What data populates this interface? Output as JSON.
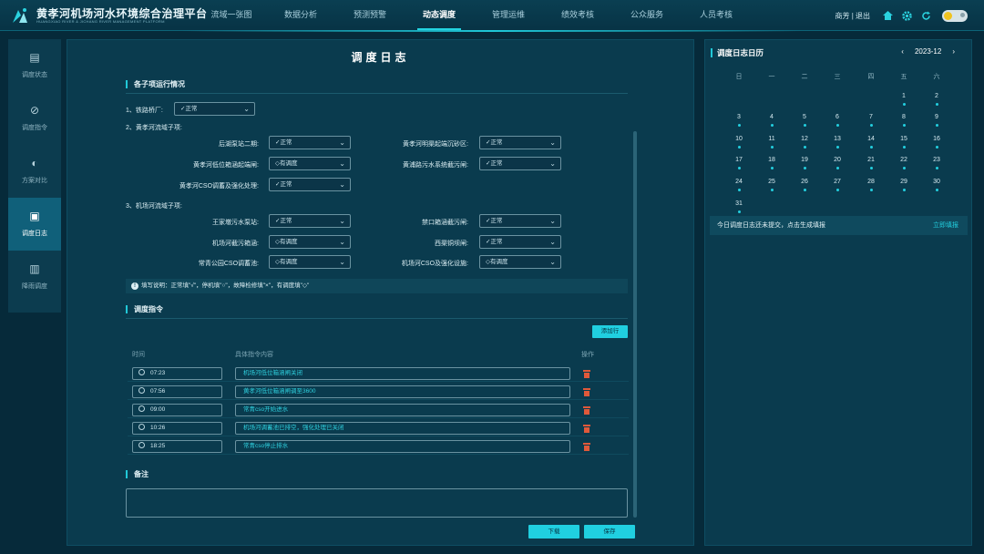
{
  "app": {
    "title": "黄孝河机场河水环境综合治理平台",
    "subtitle": "HUANGXIAO RIVER & JICHANG RIVER MANAGEMENT PLATFORM"
  },
  "nav": [
    {
      "label": "流域一张图",
      "active": false
    },
    {
      "label": "数据分析",
      "active": false
    },
    {
      "label": "预测预警",
      "active": false
    },
    {
      "label": "动态调度",
      "active": true
    },
    {
      "label": "管理运维",
      "active": false
    },
    {
      "label": "绩效考核",
      "active": false
    },
    {
      "label": "公众服务",
      "active": false
    },
    {
      "label": "人员考核",
      "active": false
    }
  ],
  "user": {
    "text": "商芳 | 退出"
  },
  "sidebar": [
    {
      "label": "调度状态",
      "icon": "clipboard-icon",
      "active": false
    },
    {
      "label": "调度指令",
      "icon": "instruction-icon",
      "active": false
    },
    {
      "label": "方案对比",
      "icon": "compare-icon",
      "active": false
    },
    {
      "label": "调度日志",
      "icon": "log-icon",
      "active": true
    },
    {
      "label": "降雨调度",
      "icon": "rain-icon",
      "active": false
    }
  ],
  "main": {
    "title": "调度日志",
    "section1": "各子项运行情况",
    "group1_label": "1、铁路桥厂:",
    "group1_value": "✓正常",
    "group2_label": "2、黄孝河流域子项:",
    "group3_label": "3、机场河流域子项:",
    "items": {
      "houhu": {
        "label": "后湖泵站二期:",
        "value": "✓正常"
      },
      "mingqu": {
        "label": "黄孝河明渠起端沉砂区:",
        "value": "✓正常"
      },
      "dikou": {
        "label": "黄孝河低位箱涵起端闸:",
        "value": "◇有调度"
      },
      "huangpu": {
        "label": "黄浦路污水系统截污闸:",
        "value": "✓正常"
      },
      "hxcso": {
        "label": "黄孝河CSO调蓄及强化处理:",
        "value": "✓正常"
      },
      "wangjiadun": {
        "label": "王家墩污水泵站:",
        "value": "✓正常"
      },
      "jinkou": {
        "label": "禁口箱涵截污闸:",
        "value": "✓正常"
      },
      "jichang": {
        "label": "机场河截污箱涵:",
        "value": "◇有调度"
      },
      "xiqu": {
        "label": "西渠铜坝闸:",
        "value": "✓正常"
      },
      "changqing": {
        "label": "常青公园CSO调蓄池:",
        "value": "◇有调度"
      },
      "jccso": {
        "label": "机场河CSO及强化设施:",
        "value": "◇有调度"
      }
    },
    "notice": "填写说明：正常填\"√\"，停机填\"○\"，故障检修填\"×\"，有调度填\"◇\"",
    "section2": "调度指令",
    "add_row": "添加行",
    "columns": {
      "time": "时间",
      "content": "具体指令内容",
      "action": "操作"
    },
    "commands": [
      {
        "time": "07:23",
        "content": "机场河低位箱涵闸关闭"
      },
      {
        "time": "07:56",
        "content": "黄孝河低位箱涵闸调至3600"
      },
      {
        "time": "09:00",
        "content": "常青cso开始进水"
      },
      {
        "time": "10:26",
        "content": "机场河调蓄池已排空，强化处理已关闭"
      },
      {
        "time": "18:25",
        "content": "常青cso停止排水"
      }
    ],
    "section3": "备注",
    "download": "下载",
    "save": "保存"
  },
  "calendar": {
    "title": "调度日志日历",
    "month": "2023-12",
    "weekdays": [
      "日",
      "一",
      "二",
      "三",
      "四",
      "五",
      "六"
    ],
    "days": [
      "1",
      "2",
      "3",
      "4",
      "5",
      "6",
      "7",
      "8",
      "9",
      "10",
      "11",
      "12",
      "13",
      "14",
      "15",
      "16",
      "17",
      "18",
      "19",
      "20",
      "21",
      "22",
      "23",
      "24",
      "25",
      "26",
      "27",
      "28",
      "29",
      "30",
      "31"
    ],
    "first_weekday": 5,
    "notice": "今日调度日志还未提交，点击生成填报",
    "link": "立即填报"
  }
}
